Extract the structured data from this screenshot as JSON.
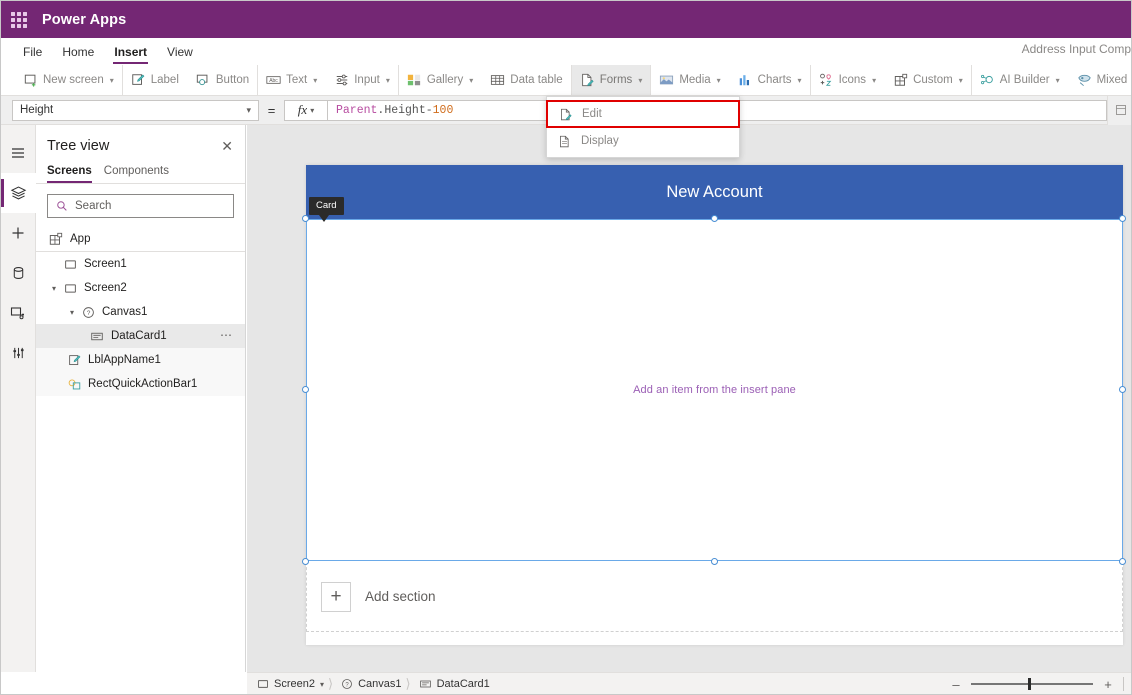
{
  "titlebar": {
    "waffle_icon": "waffle-grid-icon",
    "app_title": "Power Apps"
  },
  "menubar": {
    "items": [
      {
        "label": "File",
        "active": false
      },
      {
        "label": "Home",
        "active": false
      },
      {
        "label": "Insert",
        "active": true
      },
      {
        "label": "View",
        "active": false
      }
    ],
    "right_label": "Address Input Comp"
  },
  "ribbon": {
    "items": [
      {
        "label": "New screen",
        "icon": "new-screen-icon",
        "chevron": true
      },
      {
        "label": "Label",
        "icon": "label-icon",
        "chevron": false
      },
      {
        "label": "Button",
        "icon": "button-icon",
        "chevron": false
      },
      {
        "label": "Text",
        "icon": "text-abc-icon",
        "chevron": true
      },
      {
        "label": "Input",
        "icon": "input-slider-icon",
        "chevron": true
      },
      {
        "label": "Gallery",
        "icon": "gallery-icon",
        "chevron": true
      },
      {
        "label": "Data table",
        "icon": "data-table-icon",
        "chevron": false
      },
      {
        "label": "Forms",
        "icon": "forms-icon",
        "chevron": true,
        "active": true
      },
      {
        "label": "Media",
        "icon": "media-image-icon",
        "chevron": true
      },
      {
        "label": "Charts",
        "icon": "charts-bar-icon",
        "chevron": true
      },
      {
        "label": "Icons",
        "icon": "icons-shapes-icon",
        "chevron": true
      },
      {
        "label": "Custom",
        "icon": "custom-grid-icon",
        "chevron": true
      },
      {
        "label": "AI Builder",
        "icon": "ai-builder-icon",
        "chevron": true
      },
      {
        "label": "Mixed Reality",
        "icon": "mixed-reality-icon",
        "chevron": true
      }
    ]
  },
  "forms_dropdown": {
    "items": [
      {
        "label": "Edit",
        "icon": "edit-form-icon",
        "highlighted": true
      },
      {
        "label": "Display",
        "icon": "display-form-icon",
        "highlighted": false
      }
    ],
    "highlight_color": "#e00000"
  },
  "formula_bar": {
    "property": "Height",
    "equals": "=",
    "fx_label": "fx",
    "formula_tokens": [
      {
        "text": "Parent",
        "kind": "a"
      },
      {
        "text": ".Height",
        "kind": "b"
      },
      {
        "text": " - ",
        "kind": "op"
      },
      {
        "text": "100",
        "kind": "num"
      }
    ]
  },
  "rail": {
    "items": [
      {
        "name": "hamburger-menu-icon",
        "selected": false
      },
      {
        "name": "tree-view-icon",
        "selected": true
      },
      {
        "name": "insert-plus-icon",
        "selected": false
      },
      {
        "name": "data-cylinder-icon",
        "selected": false
      },
      {
        "name": "media-icon",
        "selected": false
      },
      {
        "name": "advanced-settings-icon",
        "selected": false
      }
    ]
  },
  "tree_panel": {
    "title": "Tree view",
    "close_icon": "close-icon",
    "tabs": [
      {
        "label": "Screens",
        "active": true
      },
      {
        "label": "Components",
        "active": false
      }
    ],
    "search_placeholder": "Search",
    "search_icon": "search-icon",
    "nodes": [
      {
        "label": "App",
        "icon": "app-icon",
        "indent": 0,
        "chevron": "",
        "selected": false,
        "band": false,
        "dots": false,
        "divider": true
      },
      {
        "label": "Screen1",
        "icon": "screen-icon",
        "indent": 0,
        "chevron": "",
        "selected": false,
        "band": false,
        "dots": false
      },
      {
        "label": "Screen2",
        "icon": "screen-icon",
        "indent": 0,
        "chevron": "expanded",
        "selected": false,
        "band": false,
        "dots": false
      },
      {
        "label": "Canvas1",
        "icon": "canvas-question-icon",
        "indent": 1,
        "chevron": "expanded",
        "selected": false,
        "band": false,
        "dots": false
      },
      {
        "label": "DataCard1",
        "icon": "datacard-icon",
        "indent": 2,
        "chevron": "",
        "selected": true,
        "band": false,
        "dots": true
      },
      {
        "label": "LblAppName1",
        "icon": "label-pen-icon",
        "indent": 1,
        "chevron": "",
        "selected": false,
        "band": true,
        "dots": false
      },
      {
        "label": "RectQuickActionBar1",
        "icon": "rect-shape-icon",
        "indent": 1,
        "chevron": "",
        "selected": false,
        "band": true,
        "dots": false
      }
    ]
  },
  "canvas": {
    "form_title": "New Account",
    "header_color": "#3760b0",
    "card_badge": "Card",
    "placeholder_text": "Add an item from the insert pane",
    "placeholder_color": "#9b5fb5",
    "add_section_label": "Add section",
    "add_section_icon": "plus-icon",
    "selection_color": "#6aa9e8"
  },
  "statusbar": {
    "breadcrumb": [
      {
        "label": "Screen2",
        "icon": "screen-icon",
        "chevron": true
      },
      {
        "label": "Canvas1",
        "icon": "canvas-question-icon",
        "chevron": false
      },
      {
        "label": "DataCard1",
        "icon": "datacard-icon",
        "chevron": false
      }
    ],
    "zoom_out_label": "–",
    "zoom_in_label": "+"
  }
}
